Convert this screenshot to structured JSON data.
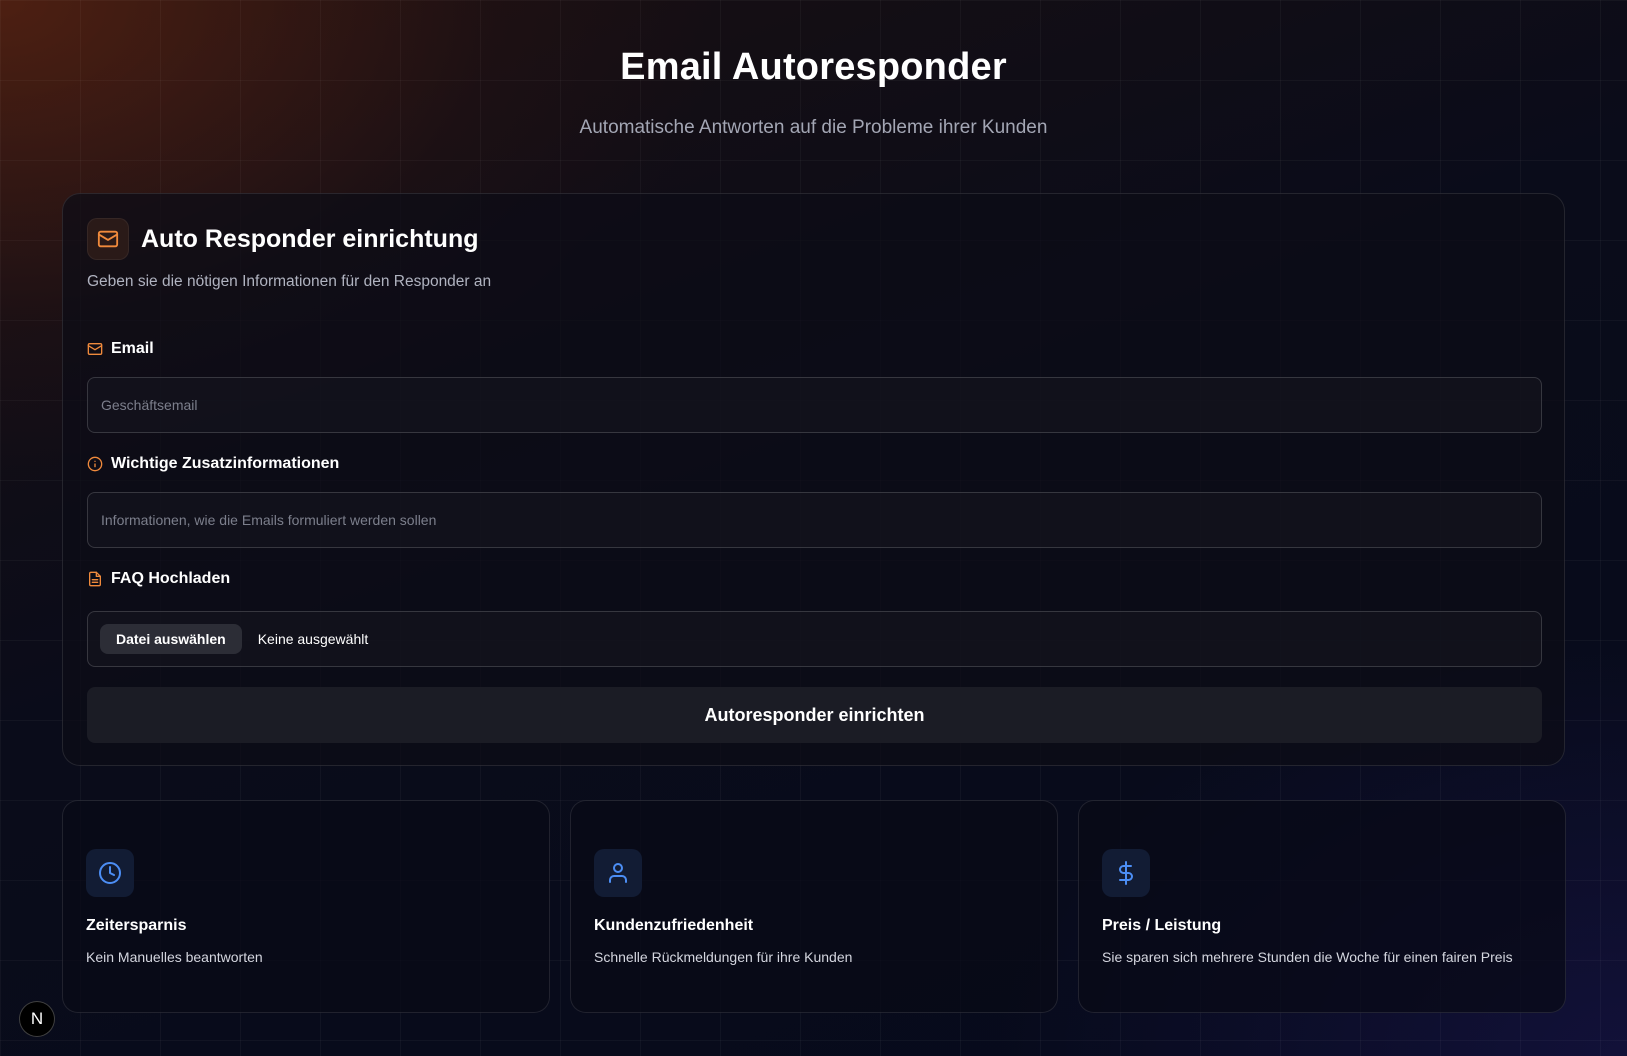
{
  "header": {
    "title": "Email Autoresponder",
    "subtitle": "Automatische Antworten auf die Probleme ihrer Kunden"
  },
  "form_card": {
    "icon": "mail-icon",
    "title": "Auto Responder einrichtung",
    "description": "Geben sie die nötigen Informationen für den Responder an",
    "email": {
      "icon": "mail-icon",
      "label": "Email",
      "placeholder": "Geschäftsemail",
      "value": ""
    },
    "info": {
      "icon": "info-icon",
      "label": "Wichtige Zusatzinformationen",
      "placeholder": "Informationen, wie die Emails formuliert werden sollen",
      "value": ""
    },
    "faq": {
      "icon": "file-icon",
      "label": "FAQ Hochladen",
      "button_label": "Datei auswählen",
      "status": "Keine ausgewählt"
    },
    "submit_label": "Autoresponder einrichten"
  },
  "features": [
    {
      "icon": "clock-icon",
      "title": "Zeitersparnis",
      "description": "Kein Manuelles beantworten"
    },
    {
      "icon": "user-icon",
      "title": "Kundenzufriedenheit",
      "description": "Schnelle Rückmeldungen für ihre Kunden"
    },
    {
      "icon": "dollar-icon",
      "title": "Preis / Leistung",
      "description": "Sie sparen sich mehrere Stunden die Woche für einen fairen Preis"
    }
  ],
  "badge": {
    "label": "N"
  },
  "colors": {
    "accent_orange": "#f08a3c",
    "accent_blue": "#4c8ef5",
    "background": "#070a19"
  }
}
